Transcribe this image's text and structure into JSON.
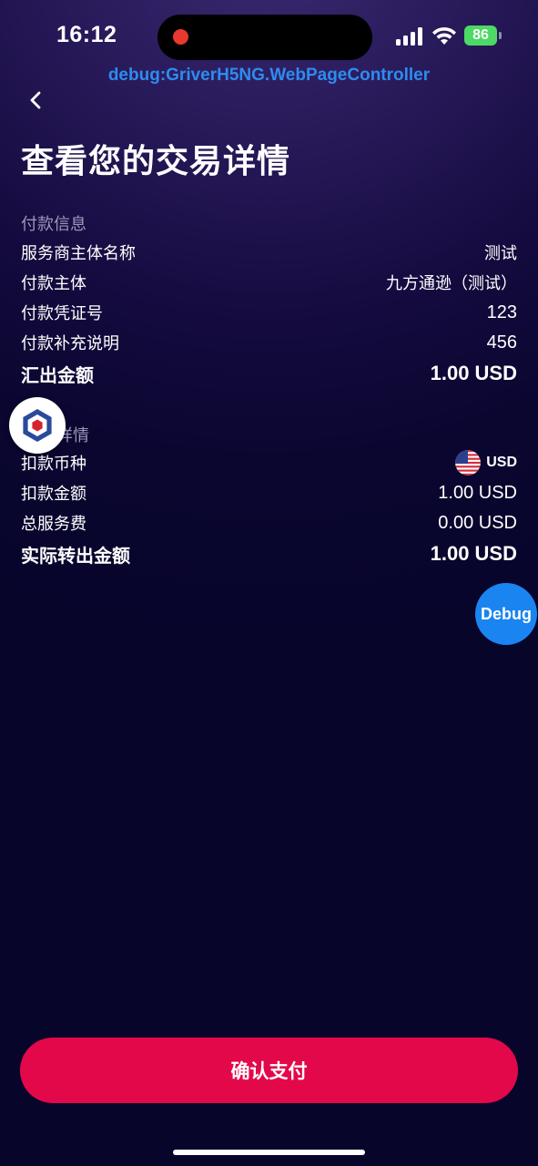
{
  "status_bar": {
    "time": "16:12",
    "battery": "86"
  },
  "debug_controller": "debug:GriverH5NG.WebPageController",
  "page_title": "查看您的交易详情",
  "payment_info": {
    "header": "付款信息",
    "rows": [
      {
        "label": "服务商主体名称",
        "value": "测试"
      },
      {
        "label": "付款主体",
        "value": "九方通逊（测试）"
      },
      {
        "label": "付款凭证号",
        "value": "123"
      },
      {
        "label": "付款补充说明",
        "value": "456"
      },
      {
        "label": "汇出金额",
        "value": "1.00 USD"
      }
    ]
  },
  "deduction_info": {
    "header_visible": "详情",
    "rows": [
      {
        "label": "扣款币种",
        "value": "USD",
        "icon": "us-flag-icon"
      },
      {
        "label": "扣款金额",
        "value": "1.00 USD"
      },
      {
        "label": "总服务费",
        "value": "0.00 USD"
      },
      {
        "label": "实际转出金额",
        "value": "1.00 USD"
      }
    ]
  },
  "debug_button": "Debug",
  "confirm_button": "确认支付",
  "colors": {
    "accent": "#e3084a",
    "debug_blue": "#1a84f0",
    "background": "#0a0630"
  }
}
